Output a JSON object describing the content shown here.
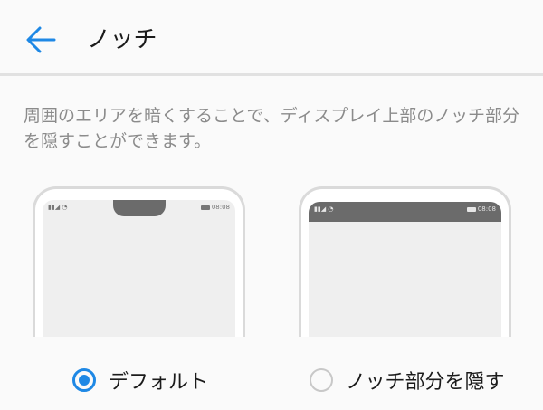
{
  "header": {
    "title": "ノッチ",
    "back_icon": "arrow-left-icon",
    "accent": "#1e88e5"
  },
  "description": "周囲のエリアを暗くすることで、ディスプレイ上部のノッチ部分を隠すことができます。",
  "previews": [
    {
      "status_left": "▮▮◢ ◔",
      "status_time": "08:08"
    },
    {
      "status_left": "▮▮◢ ◔",
      "status_time": "08:08"
    }
  ],
  "options": [
    {
      "label": "デフォルト",
      "selected": true
    },
    {
      "label": "ノッチ部分を隠す",
      "selected": false
    }
  ]
}
